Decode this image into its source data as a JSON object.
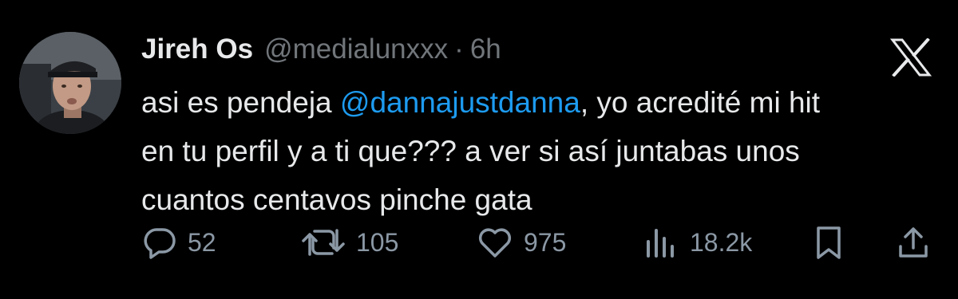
{
  "tweet": {
    "author_name": "Jireh Os",
    "author_handle": "@medialunxxx",
    "separator": "·",
    "time_ago": "6h",
    "text_line1_before": "asi es pendeja ",
    "mention": "@dannajustdanna",
    "text_line1_after": ", yo acredité mi hit",
    "text_line2": "en tu perfil y a ti que??? a ver si así juntabas unos",
    "text_line3": "cuantos centavos pinche gata"
  },
  "actions": {
    "replies": "52",
    "reposts": "105",
    "likes": "975",
    "views": "18.2k"
  },
  "icons": [
    "x-logo-icon",
    "reply-icon",
    "repost-icon",
    "like-icon",
    "views-icon",
    "bookmark-icon",
    "share-icon"
  ],
  "colors": {
    "background": "#000000",
    "text": "#e7e9ea",
    "secondary": "#71767b",
    "mention": "#1d9bf0"
  }
}
